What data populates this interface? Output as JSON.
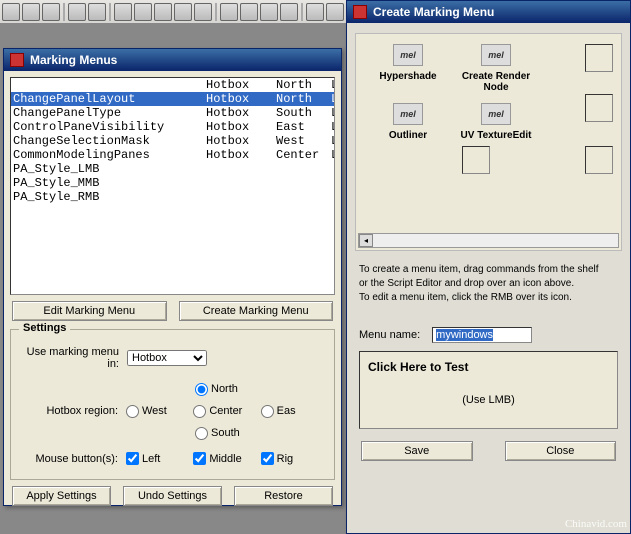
{
  "win1": {
    "title": "Marking Menus",
    "list": {
      "headers": [
        "",
        "Hotbox",
        "North",
        "Left/M"
      ],
      "rows": [
        {
          "name": "ChangePanelLayout",
          "c1": "Hotbox",
          "c2": "North",
          "c3": "Left/M",
          "sel": true
        },
        {
          "name": "ChangePanelType",
          "c1": "Hotbox",
          "c2": "South",
          "c3": "Left/M"
        },
        {
          "name": "ControlPaneVisibility",
          "c1": "Hotbox",
          "c2": "East",
          "c3": "Left/M"
        },
        {
          "name": "ChangeSelectionMask",
          "c1": "Hotbox",
          "c2": "West",
          "c3": "Left/M"
        },
        {
          "name": "CommonModelingPanes",
          "c1": "Hotbox",
          "c2": "Center",
          "c3": "Left/M"
        },
        {
          "name": "PA_Style_LMB",
          "c1": "",
          "c2": "",
          "c3": ""
        },
        {
          "name": "PA_Style_MMB",
          "c1": "",
          "c2": "",
          "c3": ""
        },
        {
          "name": "PA_Style_RMB",
          "c1": "",
          "c2": "",
          "c3": ""
        }
      ]
    },
    "buttons": {
      "edit": "Edit Marking Menu",
      "create": "Create Marking Menu"
    },
    "settings": {
      "title": "Settings",
      "use_label": "Use marking menu in:",
      "use_value": "Hotbox",
      "region_label": "Hotbox region:",
      "regions": {
        "north": "North",
        "west": "West",
        "center": "Center",
        "east": "Eas",
        "south": "South"
      },
      "mouse_label": "Mouse button(s):",
      "mouse": {
        "left": "Left",
        "middle": "Middle",
        "right": "Rig"
      }
    },
    "bottom": {
      "apply": "Apply Settings",
      "undo": "Undo Settings",
      "restore": "Restore"
    }
  },
  "win2": {
    "title": "Create Marking Menu",
    "items": [
      {
        "label": "Hypershade"
      },
      {
        "label": "Create Render Node"
      },
      {
        "label": "Outliner"
      },
      {
        "label": "UV TextureEdit"
      }
    ],
    "mel_glyph": "mel",
    "help": {
      "l1": "To create a menu item, drag commands from the shelf",
      "l2": "or the Script Editor and drop over an icon above.",
      "l3": "To edit a menu item, click the RMB over its icon."
    },
    "menu_name_label": "Menu name:",
    "menu_name_value": "mywindows",
    "test": {
      "title": "Click Here to Test",
      "sub": "(Use LMB)"
    },
    "bottom": {
      "save": "Save",
      "close": "Close"
    }
  },
  "watermark": "Chinavid.com"
}
